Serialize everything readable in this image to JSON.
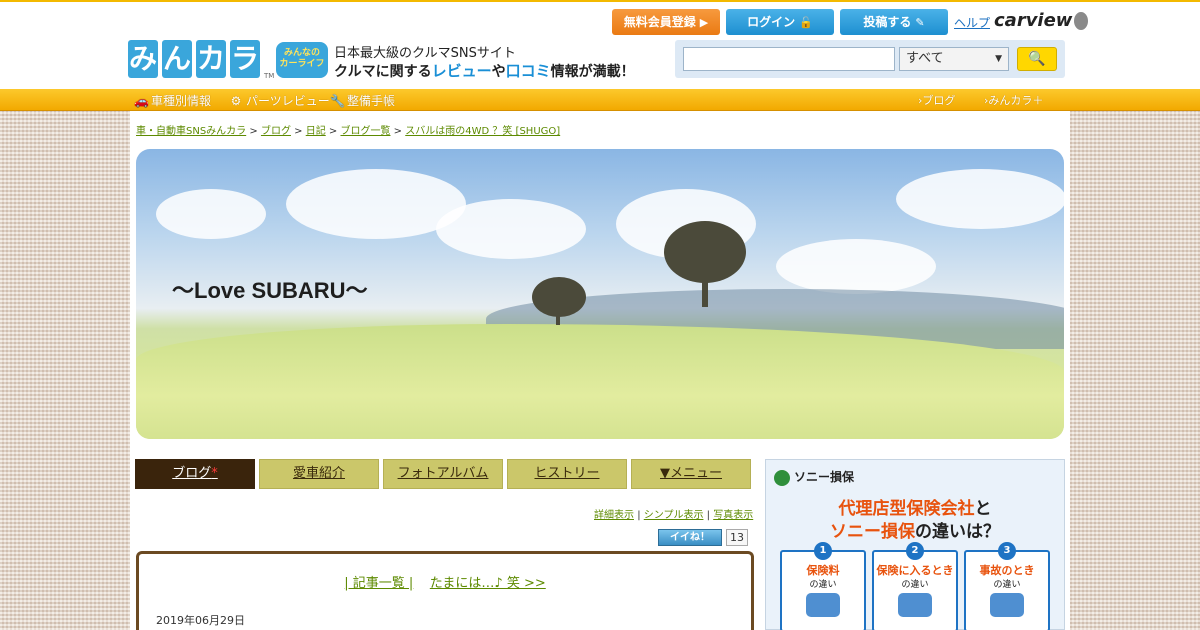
{
  "header": {
    "logo_text": [
      "み",
      "ん",
      "カ",
      "ラ"
    ],
    "logo_tm": "TM",
    "badge_top": "みんなの",
    "badge_bottom": "カーライフ",
    "tagline1": "日本最大級のクルマSNSサイト",
    "tagline2_a": "クルマに関する",
    "tagline2_review": "レビュー",
    "tagline2_b": "や",
    "tagline2_kuchikomi": "口コミ",
    "tagline2_c": "情報が満載！",
    "register_label": "無料会員登録",
    "login_label": "ログイン",
    "post_label": "投稿する",
    "help_label": "ヘルプ",
    "carview_label": "carview",
    "search_placeholder": "",
    "search_select_value": "すべて",
    "colors": {
      "accent": "#f3b900",
      "blue": "#1e8fd0",
      "orange": "#ea7a13"
    }
  },
  "nav": {
    "items": [
      {
        "label": "車種別情報",
        "icon": "car-icon"
      },
      {
        "label": "パーツレビュー",
        "icon": "gear-icon"
      },
      {
        "label": "整備手帳",
        "icon": "wrench-icon"
      }
    ],
    "right_items": [
      "ブログ",
      "みんカラ＋"
    ]
  },
  "breadcrumb": {
    "items": [
      "車・自動車SNSみんカラ",
      "ブログ",
      "日記",
      "ブログ一覧",
      "スバルは雨の4WD ？笑 [SHUGO]"
    ],
    "separator": ">"
  },
  "banner": {
    "title": "～Love SUBARU～"
  },
  "tabs": [
    {
      "label": "ブログ",
      "star": "*"
    },
    {
      "label": "愛車紹介"
    },
    {
      "label": "フォトアルバム"
    },
    {
      "label": "ヒストリー"
    },
    {
      "label": "▼メニュー"
    }
  ],
  "view_links": [
    "詳細表示",
    "シンプル表示",
    "写真表示"
  ],
  "iine": {
    "label": "イイね！",
    "count": "13"
  },
  "post": {
    "nav_list": "| 記事一覧 |",
    "nav_next": "たまには…♪ 笑 >>",
    "date": "2019年06月29日"
  },
  "ad": {
    "brand": "ソニー損保",
    "head1_a": "代理店型保険会社",
    "head1_b": "と",
    "head2_a": "ソニー損保",
    "head2_b": "の違いは？",
    "cards": [
      {
        "num": "1",
        "title": "保険料",
        "sub": "の違い"
      },
      {
        "num": "2",
        "title": "保険に入るとき",
        "sub": "の違い"
      },
      {
        "num": "3",
        "title": "事故のとき",
        "sub": "の違い"
      }
    ]
  }
}
